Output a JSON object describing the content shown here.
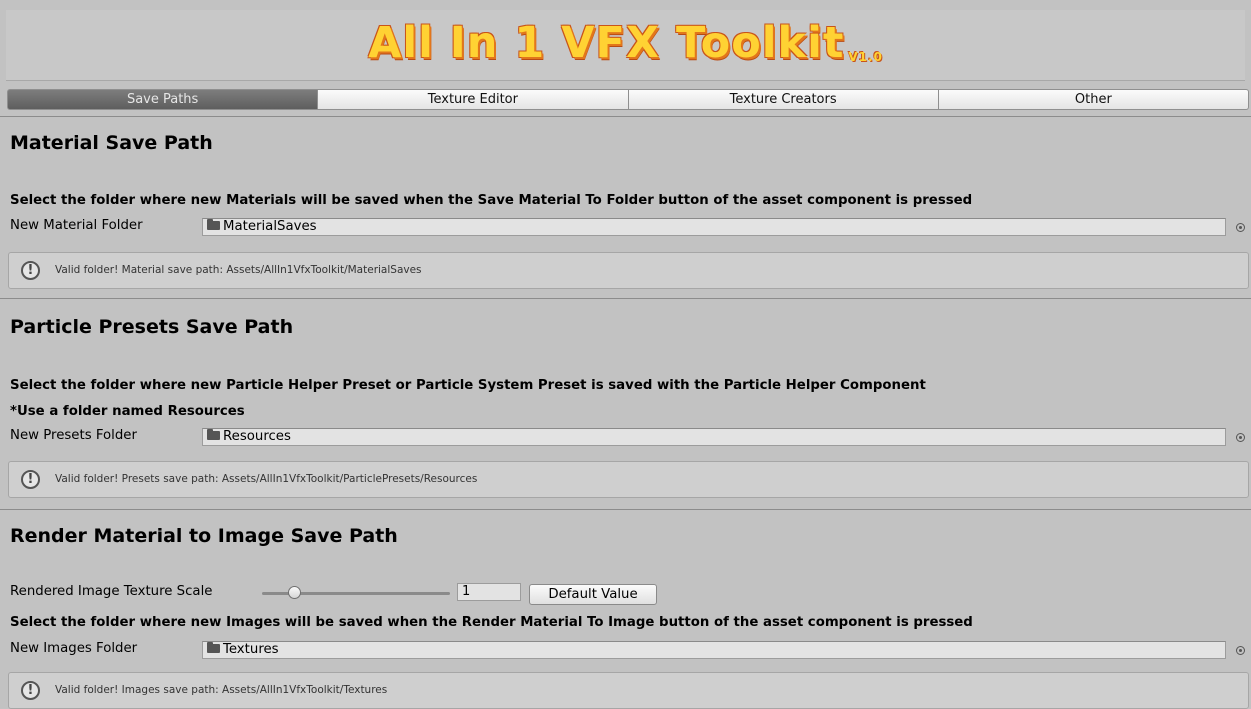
{
  "header": {
    "title": "All In 1 VFX Toolkit",
    "version": "V1.0"
  },
  "tabs": [
    {
      "label": "Save Paths",
      "active": true
    },
    {
      "label": "Texture Editor",
      "active": false
    },
    {
      "label": "Texture Creators",
      "active": false
    },
    {
      "label": "Other",
      "active": false
    }
  ],
  "material_section": {
    "title": "Material Save Path",
    "description": "Select the folder where new Materials will be saved when the Save Material To Folder button of the asset component is pressed",
    "field_label": "New Material Folder",
    "field_value": "MaterialSaves",
    "help": "Valid folder! Material save path: Assets/AllIn1VfxToolkit/MaterialSaves"
  },
  "presets_section": {
    "title": "Particle Presets Save Path",
    "description": "Select the folder where new Particle Helper Preset or Particle System Preset is saved with the Particle Helper Component",
    "note": "*Use a folder named Resources",
    "field_label": "New Presets Folder",
    "field_value": "Resources",
    "help": "Valid folder! Presets save path: Assets/AllIn1VfxToolkit/ParticlePresets/Resources"
  },
  "render_section": {
    "title": "Render Material to Image Save Path",
    "scale_label": "Rendered Image Texture Scale",
    "scale_value": "1",
    "scale_slider_fraction": 0.15,
    "default_button": "Default Value",
    "description": "Select the folder where new Images will be saved when the Render Material To Image button of the asset component is pressed",
    "field_label": "New Images Folder",
    "field_value": "Textures",
    "help": "Valid folder! Images save path: Assets/AllIn1VfxToolkit/Textures"
  },
  "icons": {
    "help": "info-exclamation-icon",
    "folder": "folder-icon",
    "picker": "object-picker-icon"
  },
  "colors": {
    "title_fill": "#ffd233",
    "title_outline": "#c8541a",
    "active_tab": "#6b6b6b",
    "background": "#c2c2c2"
  }
}
